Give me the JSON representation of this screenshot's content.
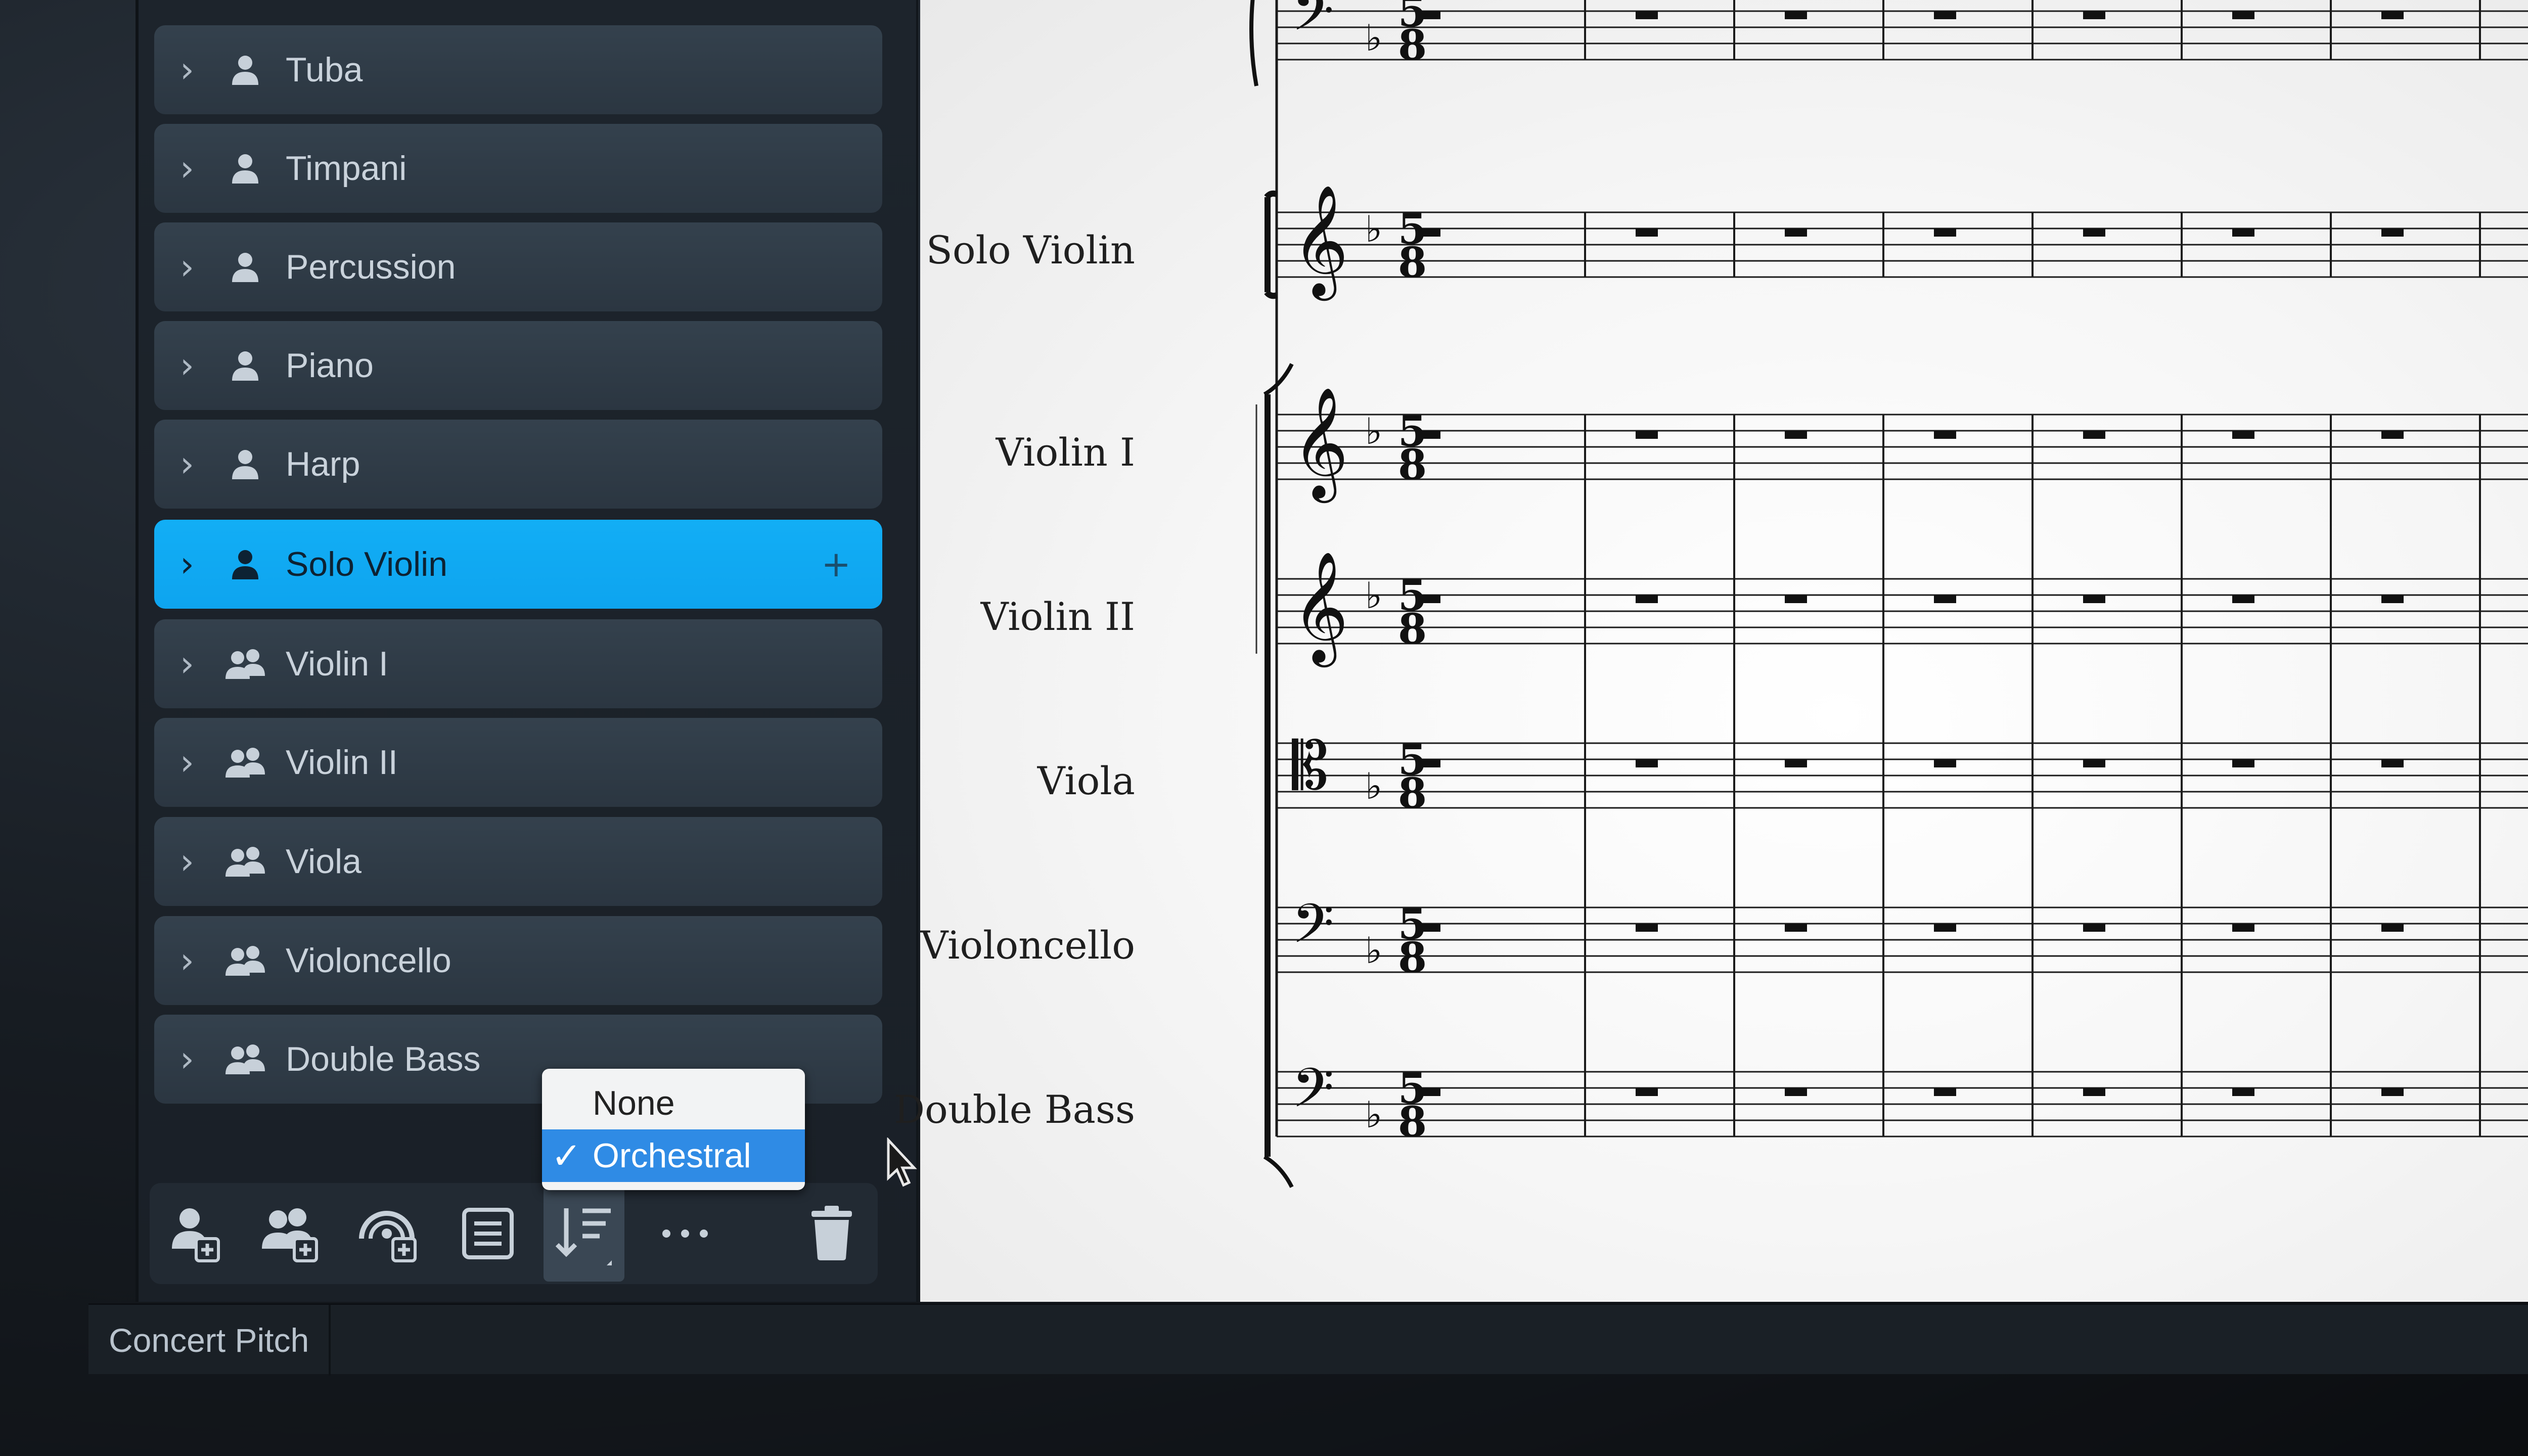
{
  "players": [
    {
      "name": "Tuba",
      "type": "single",
      "selected": false
    },
    {
      "name": "Timpani",
      "type": "single",
      "selected": false
    },
    {
      "name": "Percussion",
      "type": "single",
      "selected": false
    },
    {
      "name": "Piano",
      "type": "single",
      "selected": false
    },
    {
      "name": "Harp",
      "type": "single",
      "selected": false
    },
    {
      "name": "Solo Violin",
      "type": "single",
      "selected": true
    },
    {
      "name": "Violin I",
      "type": "section",
      "selected": false
    },
    {
      "name": "Violin II",
      "type": "section",
      "selected": false
    },
    {
      "name": "Viola",
      "type": "section",
      "selected": false
    },
    {
      "name": "Violoncello",
      "type": "section",
      "selected": false
    },
    {
      "name": "Double Bass",
      "type": "section",
      "selected": false
    }
  ],
  "selected_add_symbol": "+",
  "toolbar": [
    {
      "name": "add-single-player-icon",
      "active": false
    },
    {
      "name": "add-section-player-icon",
      "active": false
    },
    {
      "name": "add-ensemble-icon",
      "active": false
    },
    {
      "name": "list-icon",
      "active": false
    },
    {
      "name": "sort-icon",
      "active": true
    },
    {
      "name": "more-options-icon",
      "active": false
    },
    {
      "name": "trash-icon",
      "active": false
    }
  ],
  "sort_menu": {
    "options": [
      "None",
      "Orchestral"
    ],
    "selected": "Orchestral",
    "check_mark": "✓"
  },
  "score": {
    "staves": [
      {
        "name": "",
        "clef": "bass"
      },
      {
        "name": "Solo Violin",
        "clef": "treble"
      },
      {
        "name": "Violin I",
        "clef": "treble"
      },
      {
        "name": "Violin II",
        "clef": "treble"
      },
      {
        "name": "Viola",
        "clef": "alto"
      },
      {
        "name": "Violoncello",
        "clef": "bass"
      },
      {
        "name": "Double Bass",
        "clef": "bass"
      }
    ],
    "time_signature": {
      "top": "5",
      "bottom": "8"
    },
    "key_signature": "♭",
    "measures_visible": 8
  },
  "statusbar": {
    "concert_pitch": "Concert Pitch"
  },
  "colors": {
    "selection": "#12aef5",
    "menu_highlight": "#2f8be5"
  }
}
